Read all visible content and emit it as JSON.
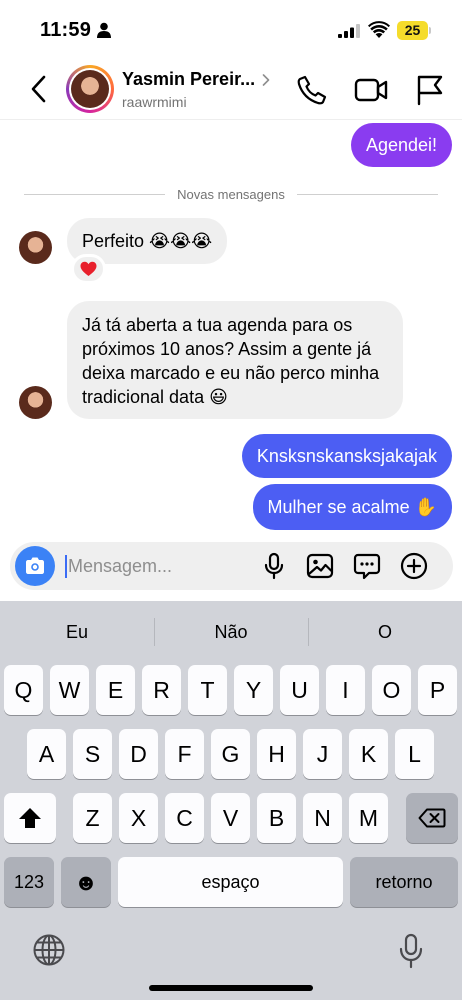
{
  "status_bar": {
    "time": "11:59",
    "battery": "25"
  },
  "header": {
    "name": "Yasmin Pereir...",
    "username": "raawrmimi"
  },
  "chat": {
    "messages": [
      {
        "direction": "out",
        "text": "Agendei!"
      },
      {
        "direction": "in",
        "text": "Perfeito 😭😭😭",
        "reaction": "❤️"
      },
      {
        "direction": "in",
        "text": "Já tá aberta a tua agenda para os próximos 10 anos? Assim a gente já deixa marcado e eu não perco minha tradicional data 😃"
      },
      {
        "direction": "out",
        "text": "Knsksnskansksjakajak"
      },
      {
        "direction": "out",
        "text": "Mulher se acalme ✋"
      }
    ],
    "divider": "Novas mensagens"
  },
  "composer": {
    "placeholder": "Mensagem..."
  },
  "keyboard": {
    "suggestions": [
      "Eu",
      "Não",
      "O"
    ],
    "row1": [
      "Q",
      "W",
      "E",
      "R",
      "T",
      "Y",
      "U",
      "I",
      "O",
      "P"
    ],
    "row2": [
      "A",
      "S",
      "D",
      "F",
      "G",
      "H",
      "J",
      "K",
      "L"
    ],
    "row3": [
      "Z",
      "X",
      "C",
      "V",
      "B",
      "N",
      "M"
    ],
    "numbers_key": "123",
    "emoji_key": "☻",
    "space_key": "espaço",
    "return_key": "retorno"
  },
  "colors": {
    "outgoing_purple": "#8a3cf0",
    "outgoing_blue": "#4c5ef3",
    "incoming_gray": "#efefef",
    "camera_blue": "#3b82f6",
    "battery_yellow": "#f5dc2b"
  },
  "icons": [
    "person-icon",
    "signal-icon",
    "wifi-icon",
    "back-chevron-icon",
    "chevron-right-icon",
    "phone-icon",
    "video-icon",
    "flag-icon",
    "heart-icon",
    "camera-icon",
    "microphone-icon",
    "gallery-icon",
    "sticker-icon",
    "plus-circle-icon",
    "shift-icon",
    "backspace-icon",
    "globe-icon",
    "dictation-icon"
  ]
}
